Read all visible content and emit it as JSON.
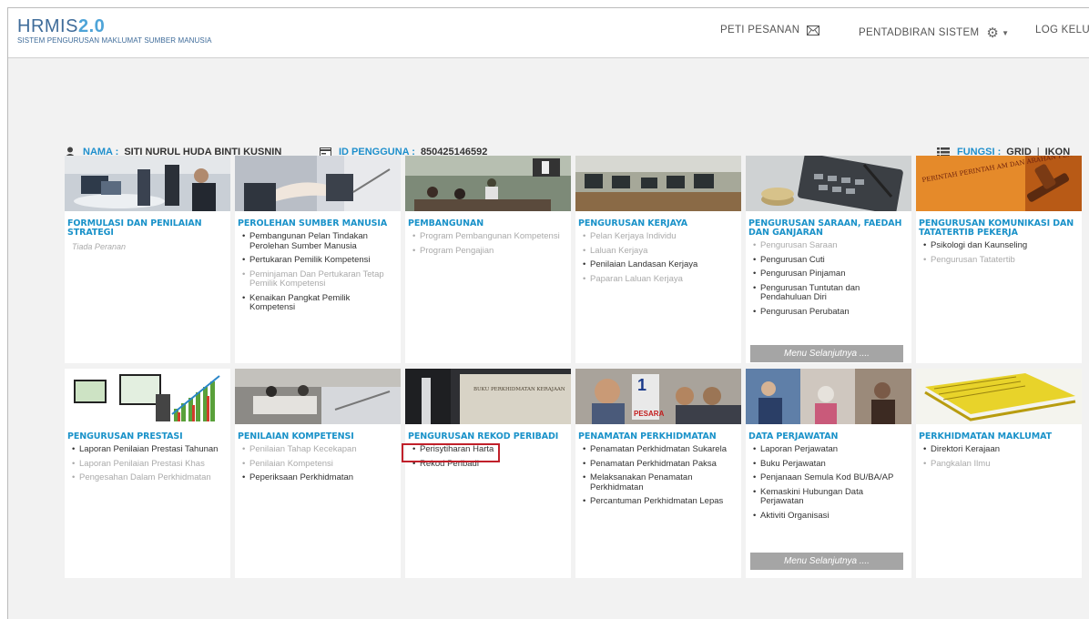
{
  "header": {
    "logo_main": "HRMIS",
    "logo_version": "2.0",
    "logo_sub": "SISTEM PENGURUSAN MAKLUMAT SUMBER MANUSIA",
    "nav": {
      "peti_pesanan": "PETI PESANAN",
      "pentadbiran": "PENTADBIRAN SISTEM",
      "log_keluar": "LOG KELUAR"
    }
  },
  "user": {
    "nama_label": "NAMA :",
    "nama_value": "SITI NURUL HUDA BINTI KUSNIN",
    "id_label": "ID PENGGUNA :",
    "id_value": "850425146592"
  },
  "fungsi": {
    "label": "FUNGSI :",
    "grid": "GRID",
    "separator": "|",
    "ikon": "IKON"
  },
  "menu_next_label": "Menu Selanjutnya ....",
  "tiles": [
    {
      "title": "FORMULASI DAN PENILAIAN STRATEGI",
      "empty": "Tiada Peranan",
      "items": []
    },
    {
      "title": "PEROLEHAN SUMBER MANUSIA",
      "items": [
        {
          "label": "Pembangunan Pelan Tindakan Perolehan Sumber Manusia",
          "enabled": true
        },
        {
          "label": "Pertukaran Pemilik Kompetensi",
          "enabled": true
        },
        {
          "label": "Peminjaman Dan Pertukaran Tetap Pemilik Kompetensi",
          "enabled": false
        },
        {
          "label": "Kenaikan Pangkat Pemilik Kompetensi",
          "enabled": true
        }
      ]
    },
    {
      "title": "PEMBANGUNAN",
      "items": [
        {
          "label": "Program Pembangunan Kompetensi",
          "enabled": false
        },
        {
          "label": "Program Pengajian",
          "enabled": false
        }
      ]
    },
    {
      "title": "PENGURUSAN KERJAYA",
      "items": [
        {
          "label": "Pelan Kerjaya Individu",
          "enabled": false
        },
        {
          "label": "Laluan Kerjaya",
          "enabled": false
        },
        {
          "label": "Penilaian Landasan Kerjaya",
          "enabled": true
        },
        {
          "label": "Paparan Laluan Kerjaya",
          "enabled": false
        }
      ]
    },
    {
      "title": "PENGURUSAN SARAAN, FAEDAH DAN GANJARAN",
      "items": [
        {
          "label": "Pengurusan Saraan",
          "enabled": false
        },
        {
          "label": "Pengurusan Cuti",
          "enabled": true
        },
        {
          "label": "Pengurusan Pinjaman",
          "enabled": true
        },
        {
          "label": "Pengurusan Tuntutan dan Pendahuluan Diri",
          "enabled": true
        },
        {
          "label": "Pengurusan Perubatan",
          "enabled": true
        }
      ],
      "has_more": true
    },
    {
      "title": "PENGURUSAN KOMUNIKASI DAN TATATERTIB PEKERJA",
      "items": [
        {
          "label": "Psikologi dan Kaunseling",
          "enabled": true
        },
        {
          "label": "Pengurusan Tatatertib",
          "enabled": false
        }
      ]
    },
    {
      "title": "PENGURUSAN PRESTASI",
      "items": [
        {
          "label": "Laporan Penilaian Prestasi Tahunan",
          "enabled": true
        },
        {
          "label": "Laporan Penilaian Prestasi Khas",
          "enabled": false
        },
        {
          "label": "Pengesahan Dalam Perkhidmatan",
          "enabled": false
        }
      ]
    },
    {
      "title": "PENILAIAN KOMPETENSI",
      "items": [
        {
          "label": "Penilaian Tahap Kecekapan",
          "enabled": false
        },
        {
          "label": "Penilaian Kompetensi",
          "enabled": false
        },
        {
          "label": "Peperiksaan Perkhidmatan",
          "enabled": true
        }
      ]
    },
    {
      "title": "PENGURUSAN REKOD PERIBADI",
      "items": [
        {
          "label": "Perisytiharan Harta",
          "enabled": true
        },
        {
          "label": "Rekod Peribadi",
          "enabled": true
        }
      ]
    },
    {
      "title": "PENAMATAN PERKHIDMATAN",
      "items": [
        {
          "label": "Penamatan Perkhidmatan Sukarela",
          "enabled": true
        },
        {
          "label": "Penamatan Perkhidmatan Paksa",
          "enabled": true
        },
        {
          "label": "Melaksanakan Penamatan Perkhidmatan",
          "enabled": true
        },
        {
          "label": "Percantuman Perkhidmatan Lepas",
          "enabled": true
        }
      ]
    },
    {
      "title": "DATA PERJAWATAN",
      "items": [
        {
          "label": "Laporan Perjawatan",
          "enabled": true
        },
        {
          "label": "Buku Perjawatan",
          "enabled": true
        },
        {
          "label": "Penjanaan Semula Kod BU/BA/AP",
          "enabled": true
        },
        {
          "label": "Kemaskini Hubungan Data Perjawatan",
          "enabled": true
        },
        {
          "label": "Aktiviti Organisasi",
          "enabled": true
        }
      ],
      "has_more": true
    },
    {
      "title": "PERKHIDMATAN MAKLUMAT",
      "items": [
        {
          "label": "Direktori Kerajaan",
          "enabled": true
        },
        {
          "label": "Pangkalan Ilmu",
          "enabled": false
        }
      ]
    }
  ],
  "banner_text": {
    "pesara": "PESARA",
    "buku": "BUKU PERKHIDMATAN KERAJAAN",
    "perintah": "PERINTAH PERINTAH AM DAN ARAHAN PENTADBIRAN"
  }
}
